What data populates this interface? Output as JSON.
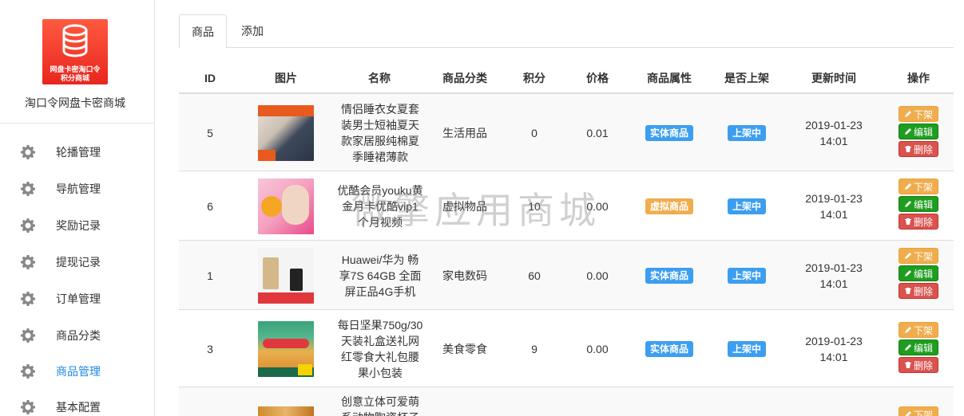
{
  "sidebar": {
    "logo": {
      "line1": "网盘卡密淘口令",
      "line2": "积分商城"
    },
    "store_name": "淘口令网盘卡密商城",
    "items": [
      {
        "label": "轮播管理",
        "icon": "gear-icon"
      },
      {
        "label": "导航管理",
        "icon": "gear-icon"
      },
      {
        "label": "奖励记录",
        "icon": "gear-icon"
      },
      {
        "label": "提现记录",
        "icon": "gear-icon"
      },
      {
        "label": "订单管理",
        "icon": "gear-icon"
      },
      {
        "label": "商品分类",
        "icon": "gear-icon"
      },
      {
        "label": "商品管理",
        "icon": "gear-icon",
        "active": true
      },
      {
        "label": "基本配置",
        "icon": "gear-icon"
      }
    ]
  },
  "tabs": [
    {
      "label": "商品",
      "active": true
    },
    {
      "label": "添加"
    }
  ],
  "table": {
    "headers": [
      "ID",
      "图片",
      "名称",
      "商品分类",
      "积分",
      "价格",
      "商品属性",
      "是否上架",
      "更新时间",
      "操作"
    ],
    "rows": [
      {
        "id": "5",
        "name": "情侣睡衣女夏套装男士短袖夏天款家居服纯棉夏季睡裙薄款",
        "category": "生活用品",
        "points": "0",
        "price": "0.01",
        "attr": "实体商品",
        "status": "上架中",
        "date": "2019-01-23",
        "time": "14:01"
      },
      {
        "id": "6",
        "name": "优酷会员youku黄金月卡优酷vip1个月视频",
        "category": "虚拟物品",
        "points": "10",
        "price": "0.00",
        "attr": "虚拟商品",
        "status": "上架中",
        "date": "2019-01-23",
        "time": "14:01"
      },
      {
        "id": "1",
        "name": "Huawei/华为 畅享7S 64GB 全面屏正品4G手机",
        "category": "家电数码",
        "points": "60",
        "price": "0.00",
        "attr": "实体商品",
        "status": "上架中",
        "date": "2019-01-23",
        "time": "14:01"
      },
      {
        "id": "3",
        "name": "每日坚果750g/30天装礼盒送礼网红零食大礼包腰果小包装",
        "category": "美食零食",
        "points": "9",
        "price": "0.00",
        "attr": "实体商品",
        "status": "上架中",
        "date": "2019-01-23",
        "time": "14:01"
      },
      {
        "id": "",
        "name": "创意立体可爱萌系动物陶瓷杯子",
        "category": "",
        "points": "",
        "price": "",
        "attr": "",
        "status": "",
        "date": "",
        "time": ""
      }
    ],
    "actions": {
      "off": "下架",
      "edit": "编辑",
      "delete": "删除"
    }
  },
  "watermark": "微擎应用商城",
  "colors": {
    "accent": "#1e88e5",
    "badge_blue": "#3c9ef0",
    "badge_orange": "#f0ad4e",
    "green": "#1f9d1f",
    "red": "#d9534f"
  }
}
